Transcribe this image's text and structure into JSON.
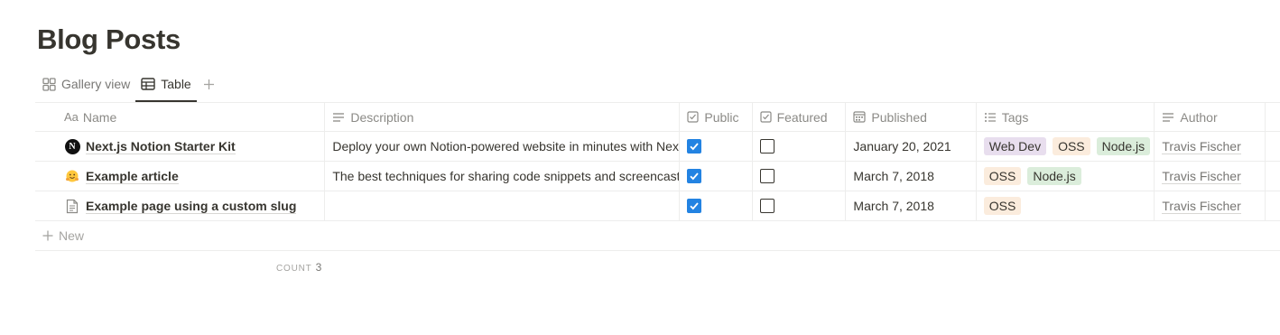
{
  "page": {
    "title": "Blog Posts"
  },
  "views": {
    "tabs": [
      {
        "label": "Gallery view",
        "icon": "gallery-icon",
        "active": false
      },
      {
        "label": "Table",
        "icon": "table-icon",
        "active": true
      }
    ],
    "add_icon": "plus-icon"
  },
  "table": {
    "columns": [
      {
        "label": "Name",
        "icon": "text-aa-icon"
      },
      {
        "label": "Description",
        "icon": "lines-icon"
      },
      {
        "label": "Public",
        "icon": "checkbox-icon"
      },
      {
        "label": "Featured",
        "icon": "checkbox-icon"
      },
      {
        "label": "Published",
        "icon": "calendar-icon"
      },
      {
        "label": "Tags",
        "icon": "list-icon"
      },
      {
        "label": "Author",
        "icon": "lines-icon"
      }
    ],
    "rows": [
      {
        "name": "Next.js Notion Starter Kit",
        "icon": "notion-logo-icon",
        "description": "Deploy your own Notion-powered website in minutes with Next.js",
        "public": true,
        "featured": false,
        "published": "January 20, 2021",
        "tags": [
          {
            "label": "Web Dev",
            "color": "#e8deee"
          },
          {
            "label": "OSS",
            "color": "#fbecdd"
          },
          {
            "label": "Node.js",
            "color": "#dbeddb"
          }
        ],
        "author": "Travis Fischer"
      },
      {
        "name": "Example article",
        "icon": "hugging-face-emoji-icon",
        "description": "The best techniques for sharing code snippets and screencasts",
        "public": true,
        "featured": false,
        "published": "March 7, 2018",
        "tags": [
          {
            "label": "OSS",
            "color": "#fbecdd"
          },
          {
            "label": "Node.js",
            "color": "#dbeddb"
          }
        ],
        "author": "Travis Fischer"
      },
      {
        "name": "Example page using a custom slug",
        "icon": "page-icon",
        "description": "",
        "public": true,
        "featured": false,
        "published": "March 7, 2018",
        "tags": [
          {
            "label": "OSS",
            "color": "#fbecdd"
          }
        ],
        "author": "Travis Fischer"
      }
    ],
    "new_label": "New",
    "count_label": "COUNT",
    "count_value": "3"
  },
  "colors": {
    "checkbox_on": "#2383e2",
    "text": "#37352f",
    "muted": "#787774"
  }
}
